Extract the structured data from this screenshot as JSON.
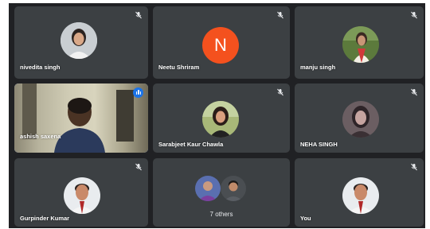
{
  "participants": [
    {
      "name": "nivedita singh",
      "muted": true
    },
    {
      "name": "Neetu Shriram",
      "muted": true,
      "initial": "N"
    },
    {
      "name": "manju singh",
      "muted": true
    },
    {
      "name": "ashish saxena",
      "speaking": true
    },
    {
      "name": "Sarabjeet Kaur Chawla",
      "muted": true
    },
    {
      "name": "NEHA SINGH",
      "muted": true
    },
    {
      "name": "Gurpinder Kumar",
      "muted": true
    },
    {
      "name": "",
      "others_label": "7 others"
    },
    {
      "name": "You",
      "muted": true
    }
  ],
  "colors": {
    "stage_bg": "#202124",
    "tile_bg": "#3c4043",
    "speaking_outline": "#8ab4f8",
    "avatar_letter_bg": "#f4511e"
  }
}
